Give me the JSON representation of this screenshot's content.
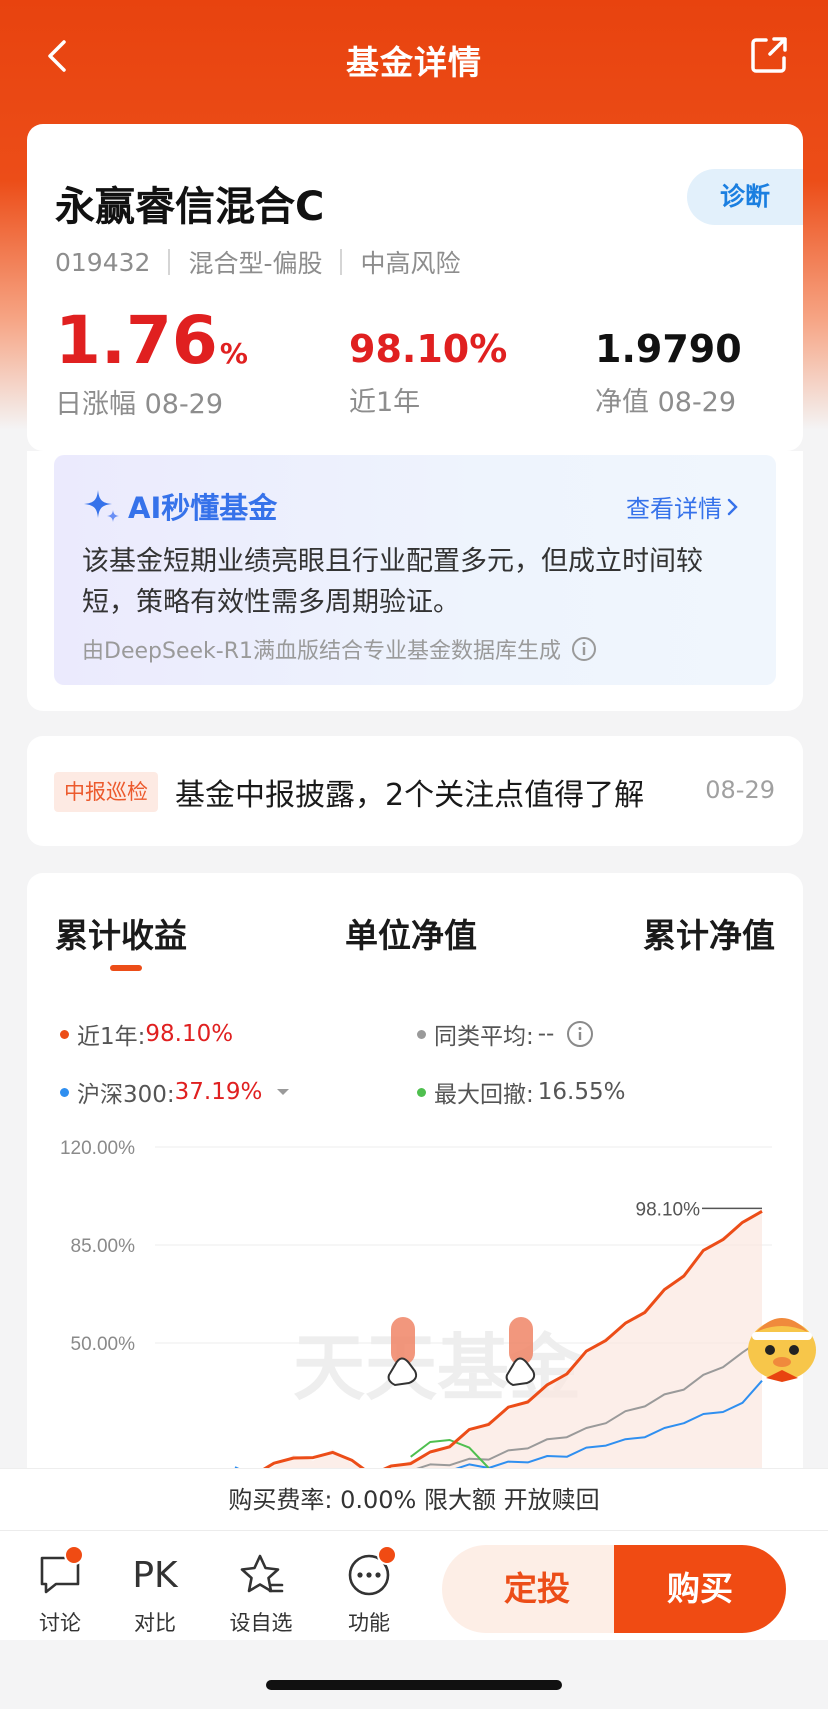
{
  "header": {
    "title": "基金详情"
  },
  "fund": {
    "name": "永赢睿信混合C",
    "diagnose_label": "诊断",
    "code": "019432",
    "type": "混合型-偏股",
    "risk": "中高风险",
    "daily_change_value": "1.76",
    "daily_change_unit": "%",
    "daily_change_label": "日涨幅 08-29",
    "year_return_value": "98.10%",
    "year_return_label": "近1年",
    "nav_value": "1.9790",
    "nav_label": "净值 08-29"
  },
  "ai": {
    "title": "AI秒懂基金",
    "link": "查看详情",
    "text": "该基金短期业绩亮眼且行业配置多元，但成立时间较短，策略有效性需多周期验证。",
    "footer": "由DeepSeek-R1满血版结合专业基金数据库生成"
  },
  "report": {
    "tag": "中报巡检",
    "text": "基金中报披露，2个关注点值得了解",
    "date": "08-29"
  },
  "chart_tabs": [
    "累计收益",
    "单位净值",
    "累计净值"
  ],
  "legend": {
    "year_label": "近1年:",
    "year_value": "98.10%",
    "peer_label": "同类平均:",
    "peer_value": "--",
    "hs300_label": "沪深300:",
    "hs300_value": "37.19%",
    "drawdown_label": "最大回撤:",
    "drawdown_value": "16.55%"
  },
  "chart_data": {
    "type": "line",
    "title": "",
    "ylabel": "",
    "yticks": [
      "120.00%",
      "85.00%",
      "50.00%"
    ],
    "ylim": [
      0,
      120
    ],
    "annotation": "98.10%",
    "watermark": "天天基金",
    "series": [
      {
        "name": "近1年",
        "color": "#ec4d18",
        "values": [
          2,
          4,
          6,
          10,
          8,
          12,
          7,
          4,
          5,
          8,
          10,
          14,
          18,
          22,
          26,
          30,
          34,
          40,
          46,
          52,
          56,
          62,
          68,
          75,
          82,
          88,
          92,
          98.1
        ]
      },
      {
        "name": "沪深300",
        "color": "#2f8ff0",
        "values": [
          5,
          3,
          2,
          3,
          2,
          1,
          2,
          3,
          3,
          4,
          4,
          5,
          6,
          6,
          7,
          8,
          9,
          10,
          12,
          14,
          15,
          17,
          19,
          22,
          24,
          26,
          28,
          37.19
        ]
      },
      {
        "name": "最大回撤",
        "color": "#4fbf4f",
        "values": [
          null,
          null,
          null,
          null,
          null,
          null,
          null,
          null,
          null,
          10,
          14,
          16,
          12,
          6,
          null,
          null,
          null,
          null,
          null,
          null,
          null,
          null,
          null,
          null,
          null,
          null,
          null,
          null
        ]
      },
      {
        "name": "同类平均",
        "color": "#9a9a9a",
        "values": [
          1,
          2,
          3,
          4,
          3,
          4,
          4,
          3,
          4,
          5,
          6,
          7,
          8,
          9,
          11,
          13,
          15,
          17,
          19,
          22,
          25,
          28,
          31,
          34,
          38,
          42,
          46,
          52
        ]
      }
    ]
  },
  "fee_bar": "购买费率: 0.00% 限大额 开放赎回",
  "bottom_nav": [
    {
      "label": "讨论"
    },
    {
      "label": "对比",
      "icon_text": "PK"
    },
    {
      "label": "设自选"
    },
    {
      "label": "功能"
    }
  ],
  "actions": {
    "ding_label": "定投",
    "buy_label": "购买"
  },
  "colors": {
    "brand": "#ec4d18",
    "up": "#e02020",
    "ai_blue": "#3672ea"
  }
}
